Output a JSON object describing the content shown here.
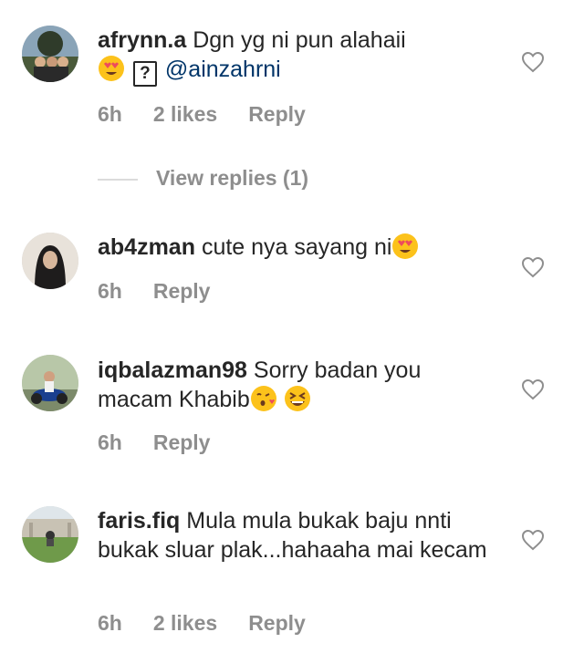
{
  "comments": [
    {
      "username": "afrynn.a",
      "text": "Dgn yg ni pun alahaii",
      "mention": "@ainzahrni",
      "time": "6h",
      "likes": "2 likes",
      "reply": "Reply"
    },
    {
      "username": "ab4zman",
      "text": "cute nya sayang ni",
      "time": "6h",
      "reply": "Reply"
    },
    {
      "username": "iqbalazman98",
      "text": "Sorry badan you macam Khabib",
      "time": "6h",
      "reply": "Reply"
    },
    {
      "username": "faris.fiq",
      "text": "Mula mula bukak baju nnti bukak sluar plak...hahaaha mai kecam",
      "time": "6h",
      "likes": "2 likes",
      "reply": "Reply"
    }
  ],
  "view_replies": "View replies (1)",
  "colors": {
    "text": "#262626",
    "meta": "#8e8e8e",
    "mention": "#003569",
    "divider": "#dbdbdb"
  },
  "icons": {
    "like": "heart-outline-icon",
    "emoji_love": "heart-eyes-emoji",
    "emoji_kiss": "kissing-heart-emoji",
    "emoji_laugh": "grinning-squinting-emoji",
    "unknown_glyph": "question-box-icon"
  }
}
